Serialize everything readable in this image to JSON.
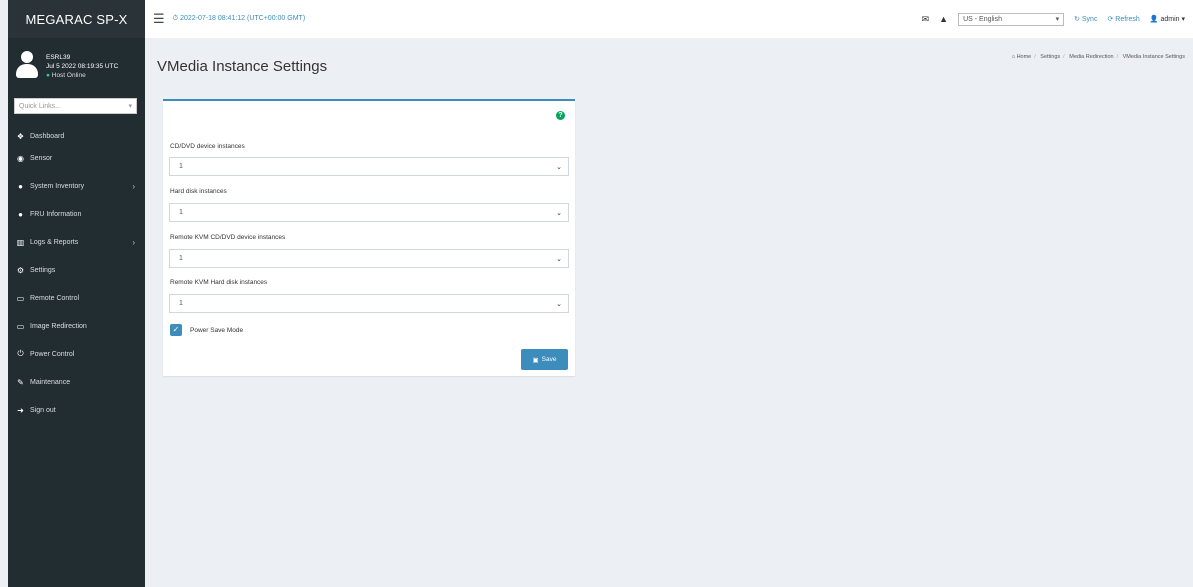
{
  "sidebar": {
    "brand": "MEGARAC SP-X",
    "user": {
      "name": "ESRL39",
      "datetime": "Jul 5 2022 08:19:35 UTC",
      "status": "Host Online"
    },
    "quick_links_placeholder": "Quick Links...",
    "items": [
      {
        "label": "Dashboard",
        "icon": "dashboard-icon",
        "glyph": "❖"
      },
      {
        "label": "Sensor",
        "icon": "sensor-icon",
        "glyph": "◉"
      },
      {
        "label": "System Inventory",
        "icon": "inventory-icon",
        "glyph": "●",
        "arrow": "›"
      },
      {
        "label": "FRU Information",
        "icon": "fru-icon",
        "glyph": "●"
      },
      {
        "label": "Logs & Reports",
        "icon": "logs-icon",
        "glyph": "▥",
        "arrow": "›"
      },
      {
        "label": "Settings",
        "icon": "settings-icon",
        "glyph": "⚙"
      },
      {
        "label": "Remote Control",
        "icon": "monitor-icon",
        "glyph": "▭"
      },
      {
        "label": "Image Redirection",
        "icon": "image-redirection-icon",
        "glyph": "▭"
      },
      {
        "label": "Power Control",
        "icon": "power-icon",
        "glyph": "⏻"
      },
      {
        "label": "Maintenance",
        "icon": "wrench-icon",
        "glyph": "✎"
      },
      {
        "label": "Sign out",
        "icon": "sign-out-icon",
        "glyph": "➜"
      }
    ]
  },
  "topbar": {
    "datetime": "2022-07-18 08:41:12 (UTC+00:00 GMT)",
    "language": "US - English",
    "sync": "Sync",
    "refresh": "Refresh",
    "user": "admin"
  },
  "page": {
    "title": "VMedia Instance Settings",
    "breadcrumb": [
      "Home",
      "Settings",
      "Media Redirection",
      "VMedia Instance Settings"
    ]
  },
  "form": {
    "fields": [
      {
        "label": "CD/DVD device instances",
        "value": "1"
      },
      {
        "label": "Hard disk instances",
        "value": "1"
      },
      {
        "label": "Remote KVM CD/DVD device instances",
        "value": "1"
      },
      {
        "label": "Remote KVM Hard disk instances",
        "value": "1"
      }
    ],
    "power_save_label": "Power Save Mode",
    "power_save_checked": true,
    "save_label": "Save"
  },
  "colors": {
    "accent": "#3c8dbc",
    "sidebar": "#222d32",
    "help": "#00a65a"
  }
}
